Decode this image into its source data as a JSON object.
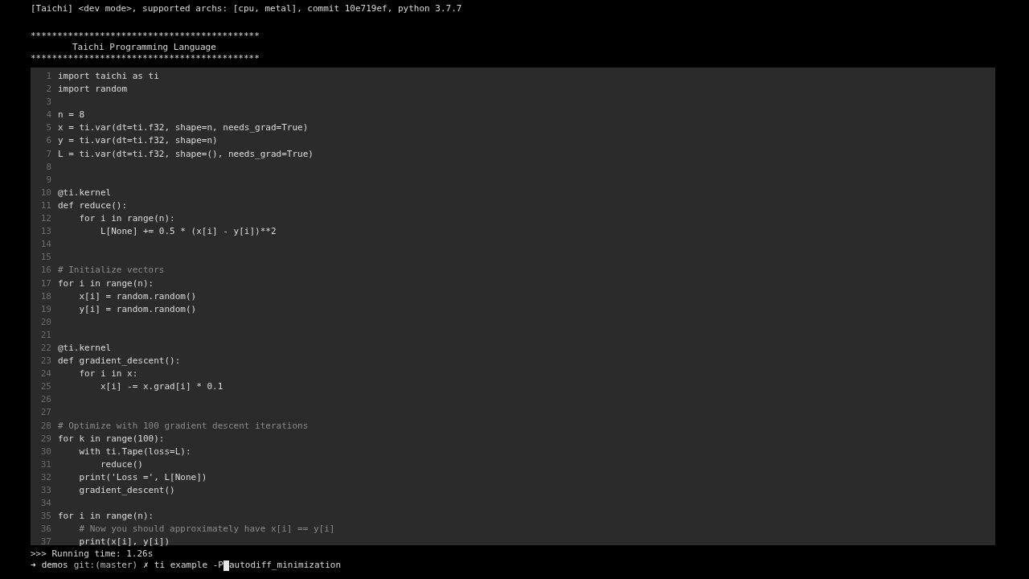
{
  "terminal": {
    "banner": "[Taichi] <dev mode>, supported archs: [cpu, metal], commit 10e719ef, python 3.7.7",
    "header": [
      {
        "kind": "rule",
        "text": "*******************************************"
      },
      {
        "kind": "title",
        "text": "Taichi Programming Language"
      },
      {
        "kind": "rule",
        "text": "*******************************************"
      }
    ],
    "code": [
      {
        "number": "1",
        "kind": "code",
        "text": "import taichi as ti"
      },
      {
        "number": "2",
        "kind": "code",
        "text": "import random"
      },
      {
        "number": "3",
        "kind": "blank"
      },
      {
        "number": "4",
        "kind": "code",
        "text": "n = 8"
      },
      {
        "number": "5",
        "kind": "code",
        "text": "x = ti.var(dt=ti.f32, shape=n, needs_grad=True)"
      },
      {
        "number": "6",
        "kind": "code",
        "text": "y = ti.var(dt=ti.f32, shape=n)"
      },
      {
        "number": "7",
        "kind": "code",
        "text": "L = ti.var(dt=ti.f32, shape=(), needs_grad=True)"
      },
      {
        "number": "8",
        "kind": "blank"
      },
      {
        "number": "9",
        "kind": "blank"
      },
      {
        "number": "10",
        "kind": "code",
        "text": "@ti.kernel"
      },
      {
        "number": "11",
        "kind": "code",
        "text": "def reduce():"
      },
      {
        "number": "12",
        "kind": "code",
        "text": "    for i in range(n):"
      },
      {
        "number": "13",
        "kind": "code",
        "text": "        L[None] += 0.5 * (x[i] - y[i])**2"
      },
      {
        "number": "14",
        "kind": "blank"
      },
      {
        "number": "15",
        "kind": "blank"
      },
      {
        "number": "16",
        "kind": "comment",
        "text": "# Initialize vectors"
      },
      {
        "number": "17",
        "kind": "code",
        "text": "for i in range(n):"
      },
      {
        "number": "18",
        "kind": "code",
        "text": "    x[i] = random.random()"
      },
      {
        "number": "19",
        "kind": "code",
        "text": "    y[i] = random.random()"
      },
      {
        "number": "20",
        "kind": "blank"
      },
      {
        "number": "21",
        "kind": "blank"
      },
      {
        "number": "22",
        "kind": "code",
        "text": "@ti.kernel"
      },
      {
        "number": "23",
        "kind": "code",
        "text": "def gradient_descent():"
      },
      {
        "number": "24",
        "kind": "code",
        "text": "    for i in x:"
      },
      {
        "number": "25",
        "kind": "code",
        "text": "        x[i] -= x.grad[i] * 0.1"
      },
      {
        "number": "26",
        "kind": "blank"
      },
      {
        "number": "27",
        "kind": "blank"
      },
      {
        "number": "28",
        "kind": "comment",
        "text": "# Optimize with 100 gradient descent iterations"
      },
      {
        "number": "29",
        "kind": "code",
        "text": "for k in range(100):"
      },
      {
        "number": "30",
        "kind": "code",
        "text": "    with ti.Tape(loss=L):"
      },
      {
        "number": "31",
        "kind": "code",
        "text": "        reduce()"
      },
      {
        "number": "32",
        "kind": "code",
        "text": "    print('Loss =', L[None])"
      },
      {
        "number": "33",
        "kind": "code",
        "text": "    gradient_descent()"
      },
      {
        "number": "34",
        "kind": "blank"
      },
      {
        "number": "35",
        "kind": "code",
        "text": "for i in range(n):"
      },
      {
        "number": "36",
        "kind": "comment",
        "text": "    # Now you should approximately have x[i] == y[i]"
      },
      {
        "number": "37",
        "kind": "code",
        "text": "    print(x[i], y[i])"
      }
    ],
    "running_time": ">>> Running time: 1.26s",
    "prompt": {
      "arrow": "➜",
      "directory": "demos",
      "git": "git:(master)",
      "dirty_mark": "✗",
      "command": "ti example -P",
      "argument": "autodiff_minimization"
    }
  }
}
